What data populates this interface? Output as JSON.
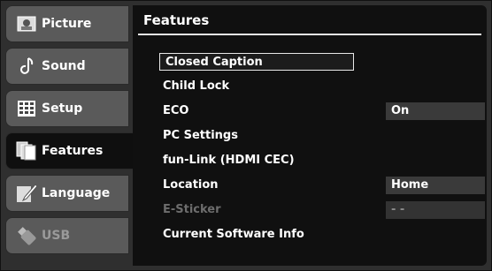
{
  "sidebar": {
    "items": [
      {
        "label": "Picture",
        "icon": "picture-icon"
      },
      {
        "label": "Sound",
        "icon": "music-note-icon"
      },
      {
        "label": "Setup",
        "icon": "grid-icon"
      },
      {
        "label": "Features",
        "icon": "documents-icon"
      },
      {
        "label": "Language",
        "icon": "pen-icon"
      },
      {
        "label": "USB",
        "icon": "usb-stick-icon"
      }
    ]
  },
  "main": {
    "title": "Features",
    "menu": [
      {
        "label": "Closed Caption",
        "value": ""
      },
      {
        "label": "Child Lock",
        "value": ""
      },
      {
        "label": "ECO",
        "value": "On"
      },
      {
        "label": "PC Settings",
        "value": ""
      },
      {
        "label": "fun-Link (HDMI CEC)",
        "value": ""
      },
      {
        "label": "Location",
        "value": "Home"
      },
      {
        "label": "E-Sticker",
        "value": "- -"
      },
      {
        "label": "Current Software Info",
        "value": ""
      }
    ]
  }
}
